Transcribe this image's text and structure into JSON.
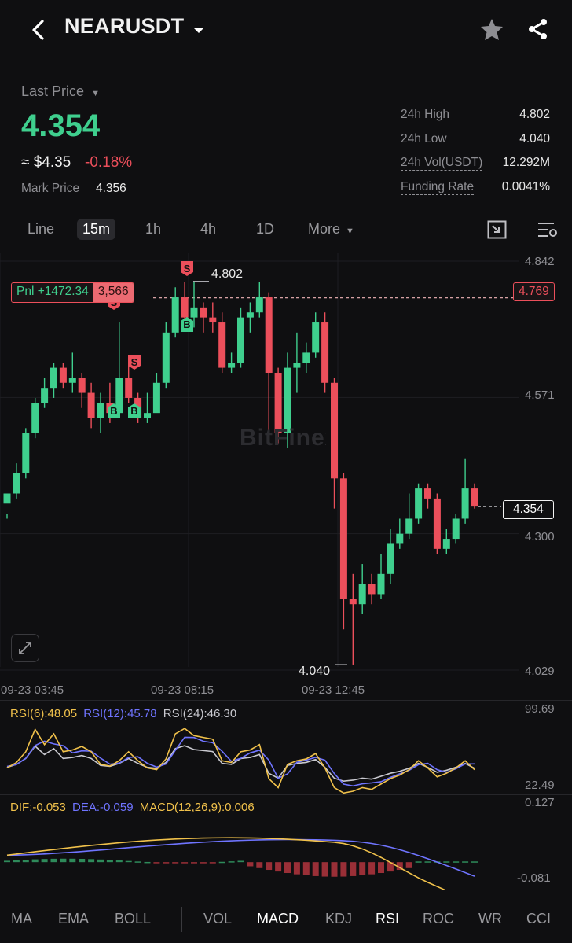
{
  "header": {
    "symbol": "NEARUSDT",
    "icons": [
      "back-icon",
      "dropdown-icon",
      "star-icon",
      "share-icon"
    ]
  },
  "price": {
    "last_price_label": "Last Price",
    "last_price": "4.354",
    "usd_approx": "≈ $4.35",
    "change_pct": "-0.18%",
    "mark_price_label": "Mark Price",
    "mark_price": "4.356"
  },
  "stats": {
    "high_label": "24h High",
    "high": "4.802",
    "low_label": "24h Low",
    "low": "4.040",
    "vol_label": "24h Vol(USDT)",
    "vol": "12.292M",
    "funding_label": "Funding Rate",
    "funding": "0.0041%"
  },
  "timeframes": {
    "line": "Line",
    "m15": "15m",
    "h1": "1h",
    "h4": "4h",
    "d1": "1D",
    "more": "More"
  },
  "chart": {
    "y_ticks": [
      "4.842",
      "4.571",
      "4.300",
      "4.029"
    ],
    "x_ticks": [
      "09-23 03:45",
      "09-23 08:15",
      "09-23 12:45"
    ],
    "high_marker": "4.802",
    "low_marker": "4.040",
    "pnl_label": "Pnl +1472.34",
    "position_qty": "3,566",
    "entry_price": "4.769",
    "current_price": "4.354",
    "watermark": "BitFinex",
    "sell_marker": "S",
    "buy_marker": "B"
  },
  "rsi": {
    "rsi6": "RSI(6):48.05",
    "rsi12": "RSI(12):45.78",
    "rsi24": "RSI(24):46.30",
    "max": "99.69",
    "min": "22.49"
  },
  "macd": {
    "dif": "DIF:-0.053",
    "dea": "DEA:-0.059",
    "macd": "MACD(12,26,9):0.006",
    "max": "0.127",
    "min": "-0.081"
  },
  "indicators": {
    "ma": "MA",
    "ema": "EMA",
    "boll": "BOLL",
    "vol": "VOL",
    "macd": "MACD",
    "kdj": "KDJ",
    "rsi": "RSI",
    "roc": "ROC",
    "wr": "WR",
    "cci": "CCI"
  },
  "colors": {
    "up": "#3fcf8e",
    "down": "#ec4f5b",
    "rsi6": "#f0c14b",
    "rsi12": "#6f74ff",
    "rsi24": "#c9c9d0"
  },
  "chart_data": {
    "type": "candlestick",
    "ylim": [
      4.029,
      4.842
    ],
    "candles": [
      [
        4.36,
        4.38,
        4.34,
        4.33
      ],
      [
        4.38,
        4.42,
        4.44,
        4.37
      ],
      [
        4.42,
        4.5,
        4.51,
        4.41
      ],
      [
        4.5,
        4.56,
        4.57,
        4.49
      ],
      [
        4.56,
        4.59,
        4.61,
        4.55
      ],
      [
        4.59,
        4.63,
        4.64,
        4.57
      ],
      [
        4.63,
        4.6,
        4.64,
        4.59
      ],
      [
        4.6,
        4.61,
        4.66,
        4.58
      ],
      [
        4.61,
        4.58,
        4.62,
        4.55
      ],
      [
        4.58,
        4.53,
        4.6,
        4.51
      ],
      [
        4.53,
        4.56,
        4.58,
        4.5
      ],
      [
        4.56,
        4.54,
        4.6,
        4.52
      ],
      [
        4.54,
        4.61,
        4.72,
        4.53
      ],
      [
        4.61,
        4.57,
        4.65,
        4.56
      ],
      [
        4.57,
        4.53,
        4.58,
        4.52
      ],
      [
        4.53,
        4.54,
        4.58,
        4.52
      ],
      [
        4.54,
        4.6,
        4.62,
        4.55
      ],
      [
        4.6,
        4.7,
        4.72,
        4.59
      ],
      [
        4.7,
        4.77,
        4.79,
        4.69
      ],
      [
        4.77,
        4.73,
        4.8,
        4.71
      ],
      [
        4.73,
        4.75,
        4.802,
        4.71
      ],
      [
        4.75,
        4.73,
        4.76,
        4.7
      ],
      [
        4.73,
        4.72,
        4.76,
        4.7
      ],
      [
        4.72,
        4.63,
        4.74,
        4.62
      ],
      [
        4.63,
        4.64,
        4.66,
        4.62
      ],
      [
        4.64,
        4.73,
        4.75,
        4.63
      ],
      [
        4.73,
        4.74,
        4.76,
        4.7
      ],
      [
        4.74,
        4.77,
        4.8,
        4.73
      ],
      [
        4.77,
        4.62,
        4.78,
        4.48
      ],
      [
        4.62,
        4.5,
        4.63,
        4.48
      ],
      [
        4.5,
        4.63,
        4.66,
        4.47
      ],
      [
        4.63,
        4.64,
        4.7,
        4.58
      ],
      [
        4.64,
        4.66,
        4.68,
        4.62
      ],
      [
        4.66,
        4.72,
        4.74,
        4.65
      ],
      [
        4.72,
        4.6,
        4.74,
        4.58
      ],
      [
        4.6,
        4.41,
        4.61,
        4.35
      ],
      [
        4.41,
        4.17,
        4.42,
        4.11
      ],
      [
        4.17,
        4.16,
        4.22,
        4.04
      ],
      [
        4.16,
        4.2,
        4.24,
        4.14
      ],
      [
        4.2,
        4.18,
        4.22,
        4.16
      ],
      [
        4.18,
        4.22,
        4.26,
        4.17
      ],
      [
        4.22,
        4.28,
        4.31,
        4.2
      ],
      [
        4.28,
        4.3,
        4.33,
        4.27
      ],
      [
        4.3,
        4.33,
        4.38,
        4.29
      ],
      [
        4.33,
        4.39,
        4.4,
        4.32
      ],
      [
        4.39,
        4.37,
        4.4,
        4.35
      ],
      [
        4.37,
        4.27,
        4.38,
        4.26
      ],
      [
        4.27,
        4.29,
        4.31,
        4.26
      ],
      [
        4.29,
        4.33,
        4.34,
        4.28
      ],
      [
        4.33,
        4.39,
        4.45,
        4.32
      ],
      [
        4.39,
        4.354,
        4.4,
        4.35
      ]
    ],
    "rsi_range": [
      22.49,
      99.69
    ],
    "macd_range": [
      -0.081,
      0.127
    ]
  }
}
